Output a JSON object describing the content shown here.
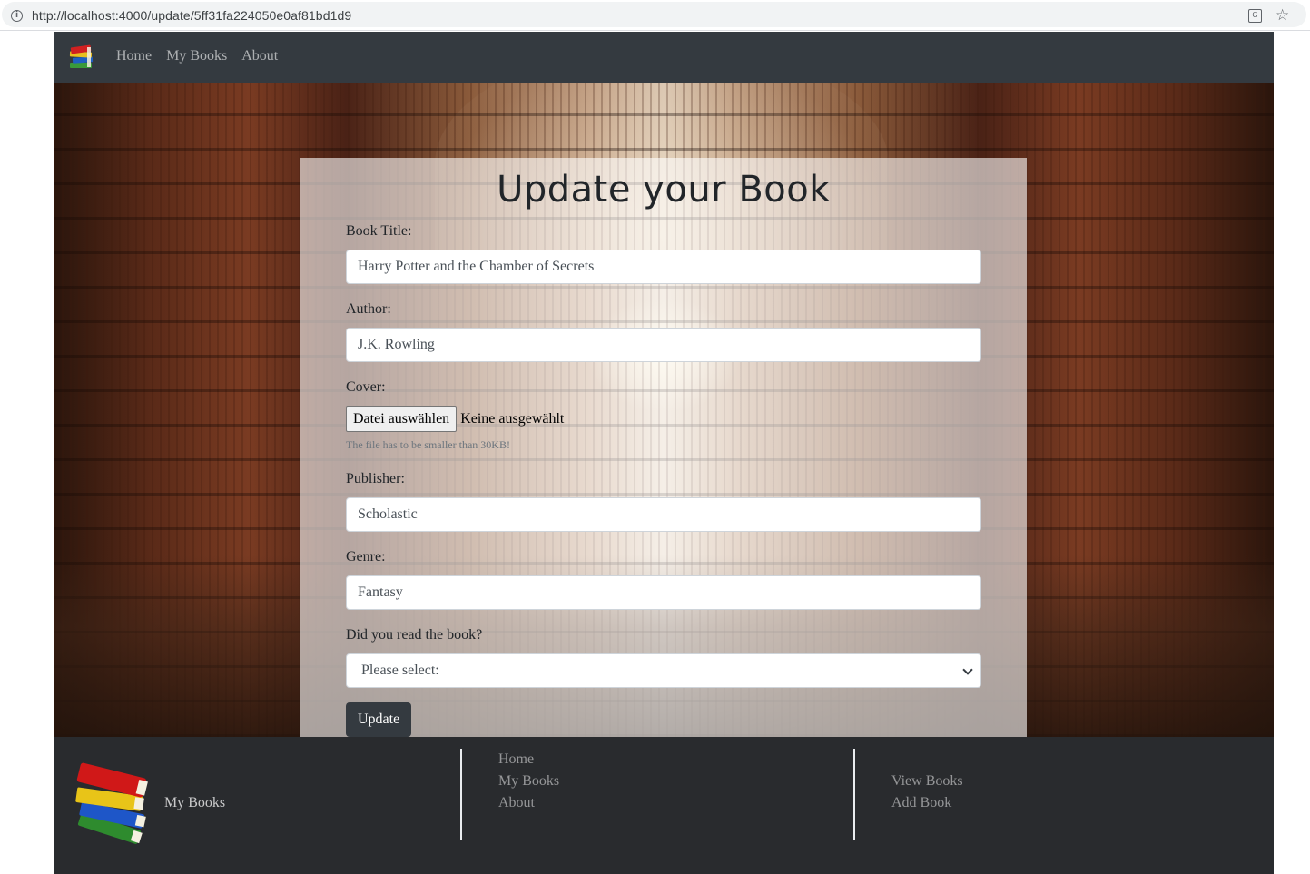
{
  "browser": {
    "url": "http://localhost:4000/update/5ff31fa224050e0af81bd1d9"
  },
  "navbar": {
    "links": [
      {
        "label": "Home"
      },
      {
        "label": "My Books"
      },
      {
        "label": "About"
      }
    ]
  },
  "form": {
    "title": "Update your Book",
    "book_title": {
      "label": "Book Title:",
      "value": "Harry Potter and the Chamber of Secrets"
    },
    "author": {
      "label": "Author:",
      "value": "J.K. Rowling"
    },
    "cover": {
      "label": "Cover:",
      "button_label": "Datei auswählen",
      "status": "Keine ausgewählt",
      "help": "The file has to be smaller than 30KB!"
    },
    "publisher": {
      "label": "Publisher:",
      "value": "Scholastic"
    },
    "genre": {
      "label": "Genre:",
      "value": "Fantasy"
    },
    "read": {
      "label": "Did you read the book?",
      "selected": "Please select:"
    },
    "submit_label": "Update"
  },
  "footer": {
    "brand": "My Books",
    "col1": [
      {
        "label": "Home"
      },
      {
        "label": "My Books"
      },
      {
        "label": "About"
      }
    ],
    "col2": [
      {
        "label": "View Books"
      },
      {
        "label": "Add Book"
      }
    ]
  },
  "colors": {
    "navbar": "#343a40",
    "footer": "#292b2e",
    "button": "#343a40"
  }
}
